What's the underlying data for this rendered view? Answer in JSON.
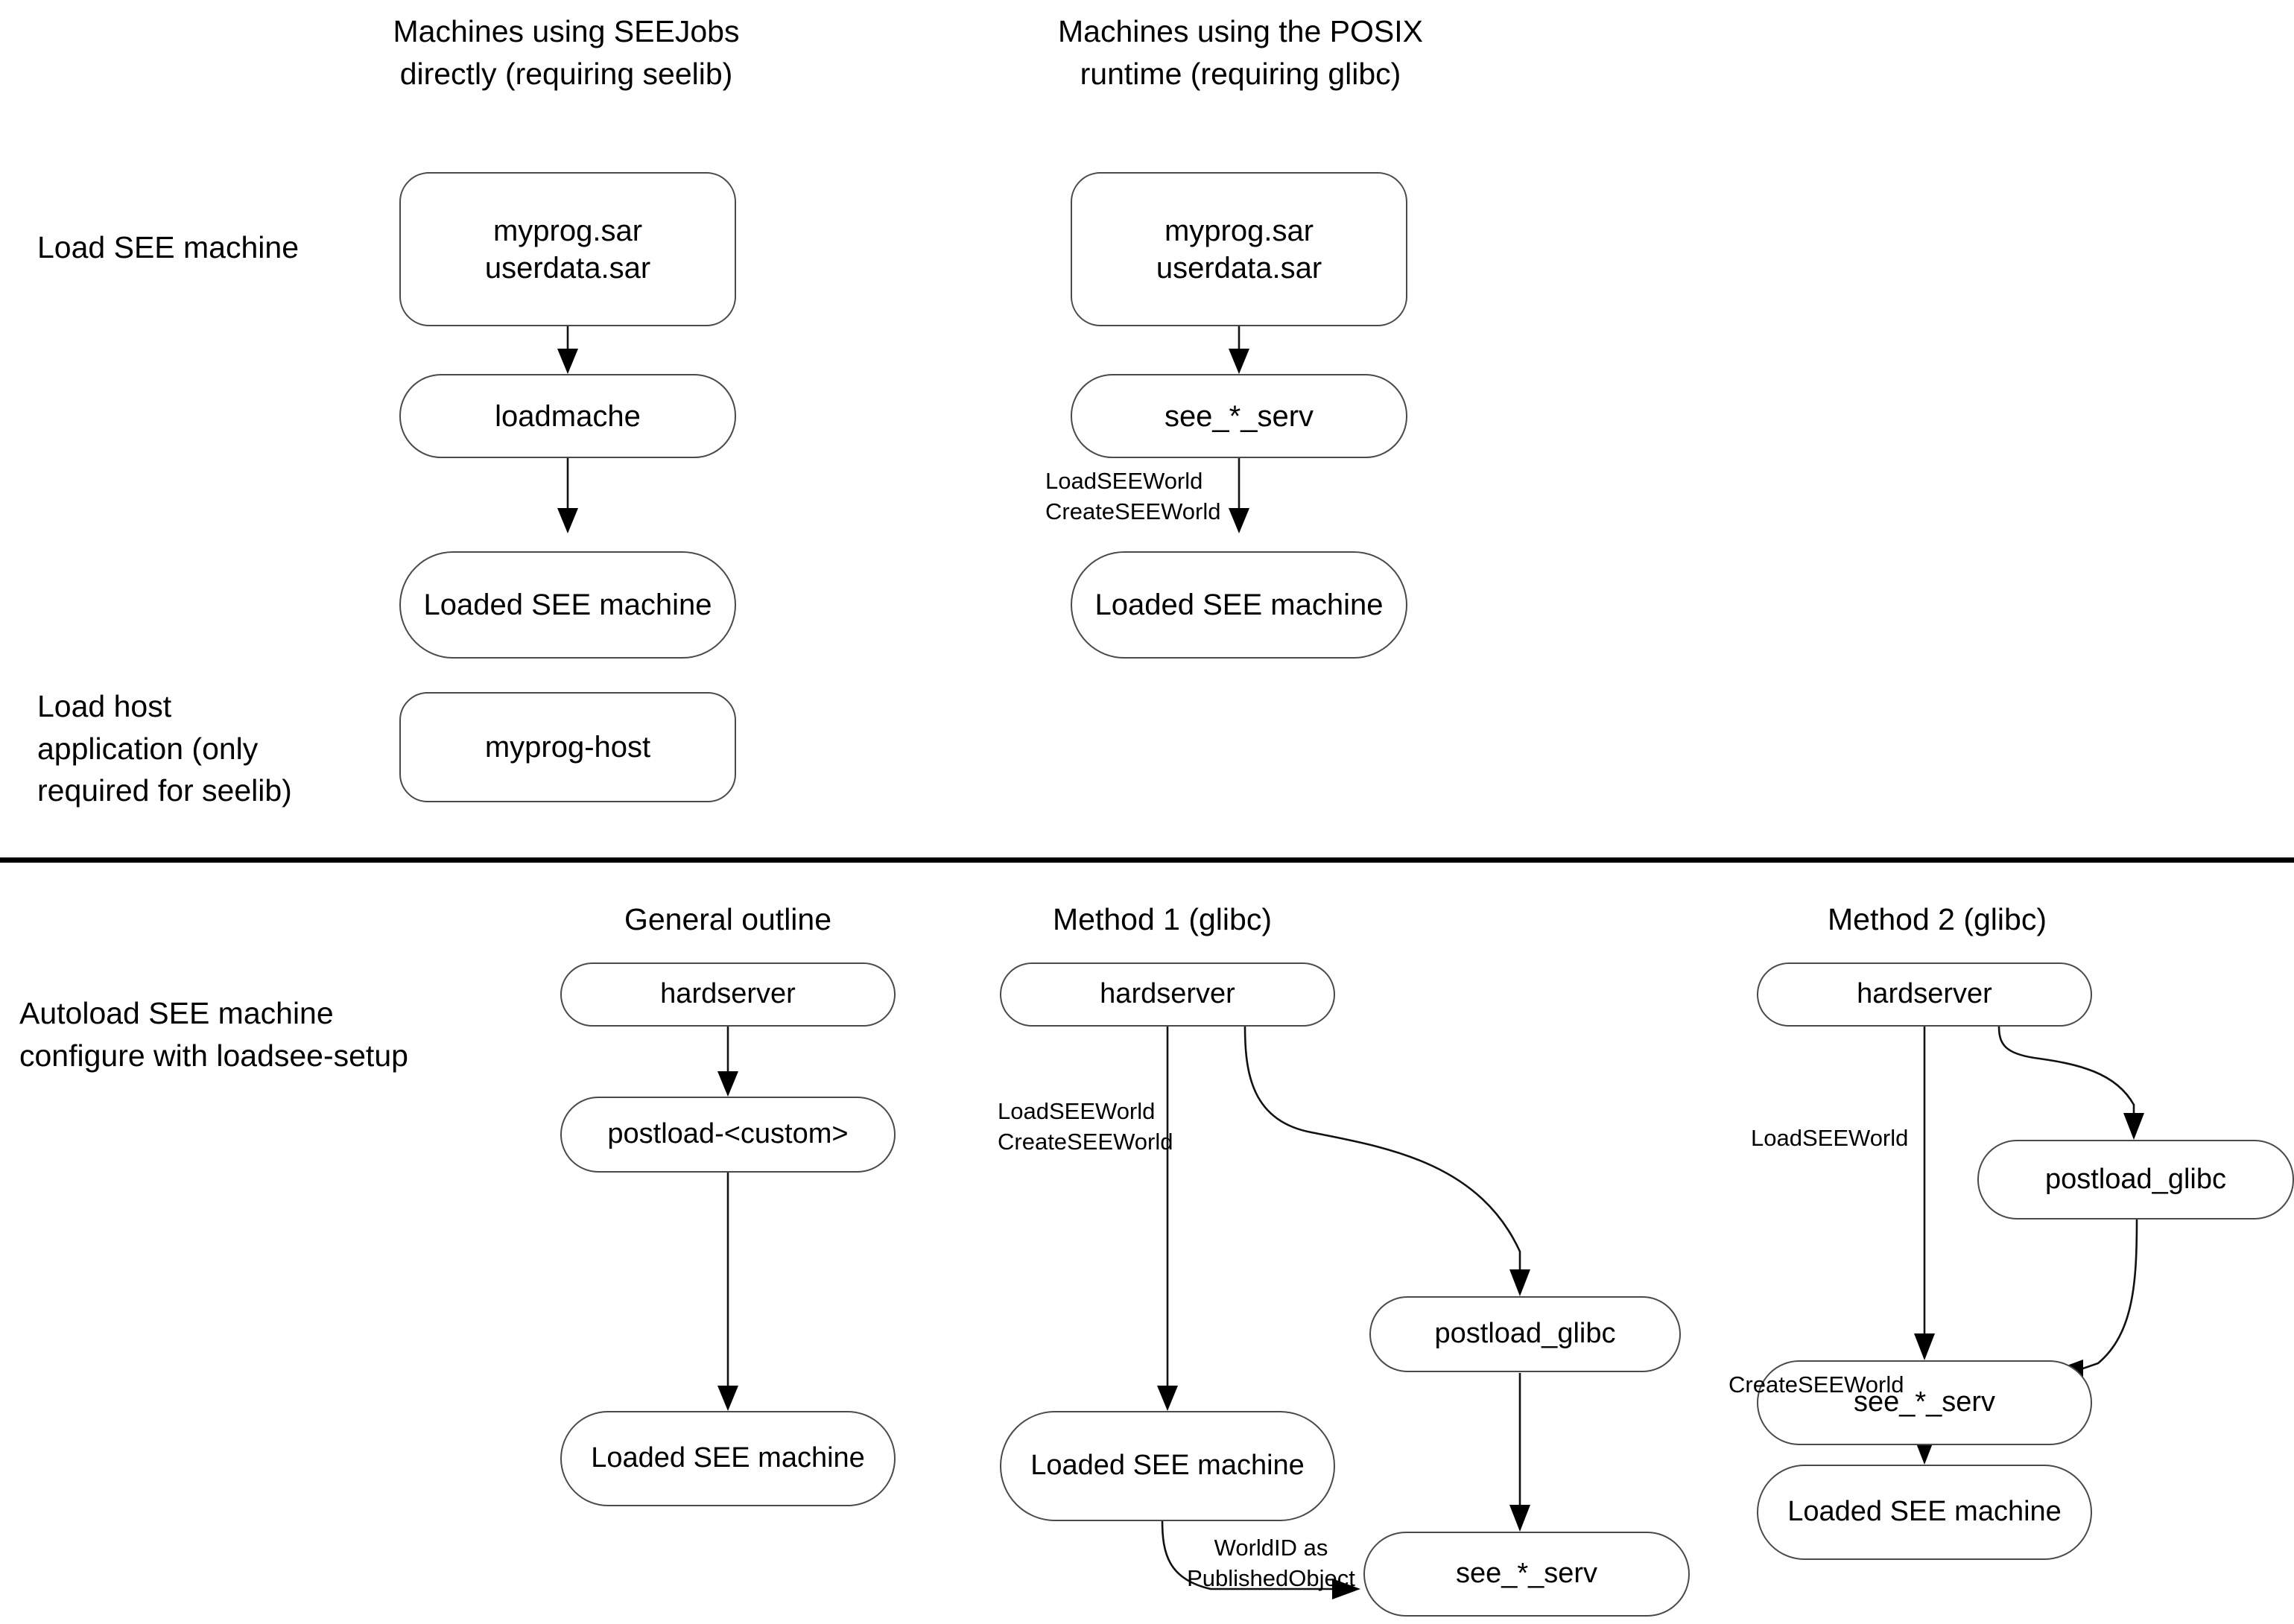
{
  "diagram": {
    "title_top_left": "Machines using SEEJobs\ndirectly (requiring seelib)",
    "title_top_right": "Machines using the POSIX\nruntime (requiring glibc)",
    "row_label_load_see": "Load SEE machine",
    "row_label_load_host": "Load host\napplication (only\nrequired for seelib)",
    "row_label_autoload": "Autoload SEE machine\nconfigure with loadsee-setup",
    "title_general_outline": "General outline",
    "title_method1": "Method 1 (glibc)",
    "title_method2": "Method 2 (glibc)",
    "nodes": {
      "tl_sar": "myprog.sar\nuserdata.sar",
      "tl_loadmache": "loadmache",
      "tl_loaded": "Loaded SEE machine",
      "tl_myprog_host": "myprog-host",
      "tr_sar": "myprog.sar\nuserdata.sar",
      "tr_see_serv": "see_*_serv",
      "tr_loaded": "Loaded SEE machine",
      "go_hardserver": "hardserver",
      "go_postload_custom": "postload-<custom>",
      "go_loaded": "Loaded SEE machine",
      "m1_hardserver": "hardserver",
      "m1_postload_glibc": "postload_glibc",
      "m1_loaded": "Loaded SEE machine",
      "m1_see_serv": "see_*_serv",
      "m2_hardserver": "hardserver",
      "m2_postload_glibc": "postload_glibc",
      "m2_see_serv": "see_*_serv",
      "m2_loaded": "Loaded SEE machine"
    },
    "edge_labels": {
      "tr_load_create": "LoadSEEWorld\nCreateSEEWorld",
      "m1_load_create": "LoadSEEWorld\nCreateSEEWorld",
      "m1_worldid": "WorldID as\nPublishedObject",
      "m2_load": "LoadSEEWorld",
      "m2_create": "CreateSEEWorld"
    },
    "colors": {
      "background": "#ffffff",
      "node_border": "#4a4a4a",
      "edge_stroke": "#111111",
      "text": "#000000",
      "rule": "#000000"
    }
  }
}
